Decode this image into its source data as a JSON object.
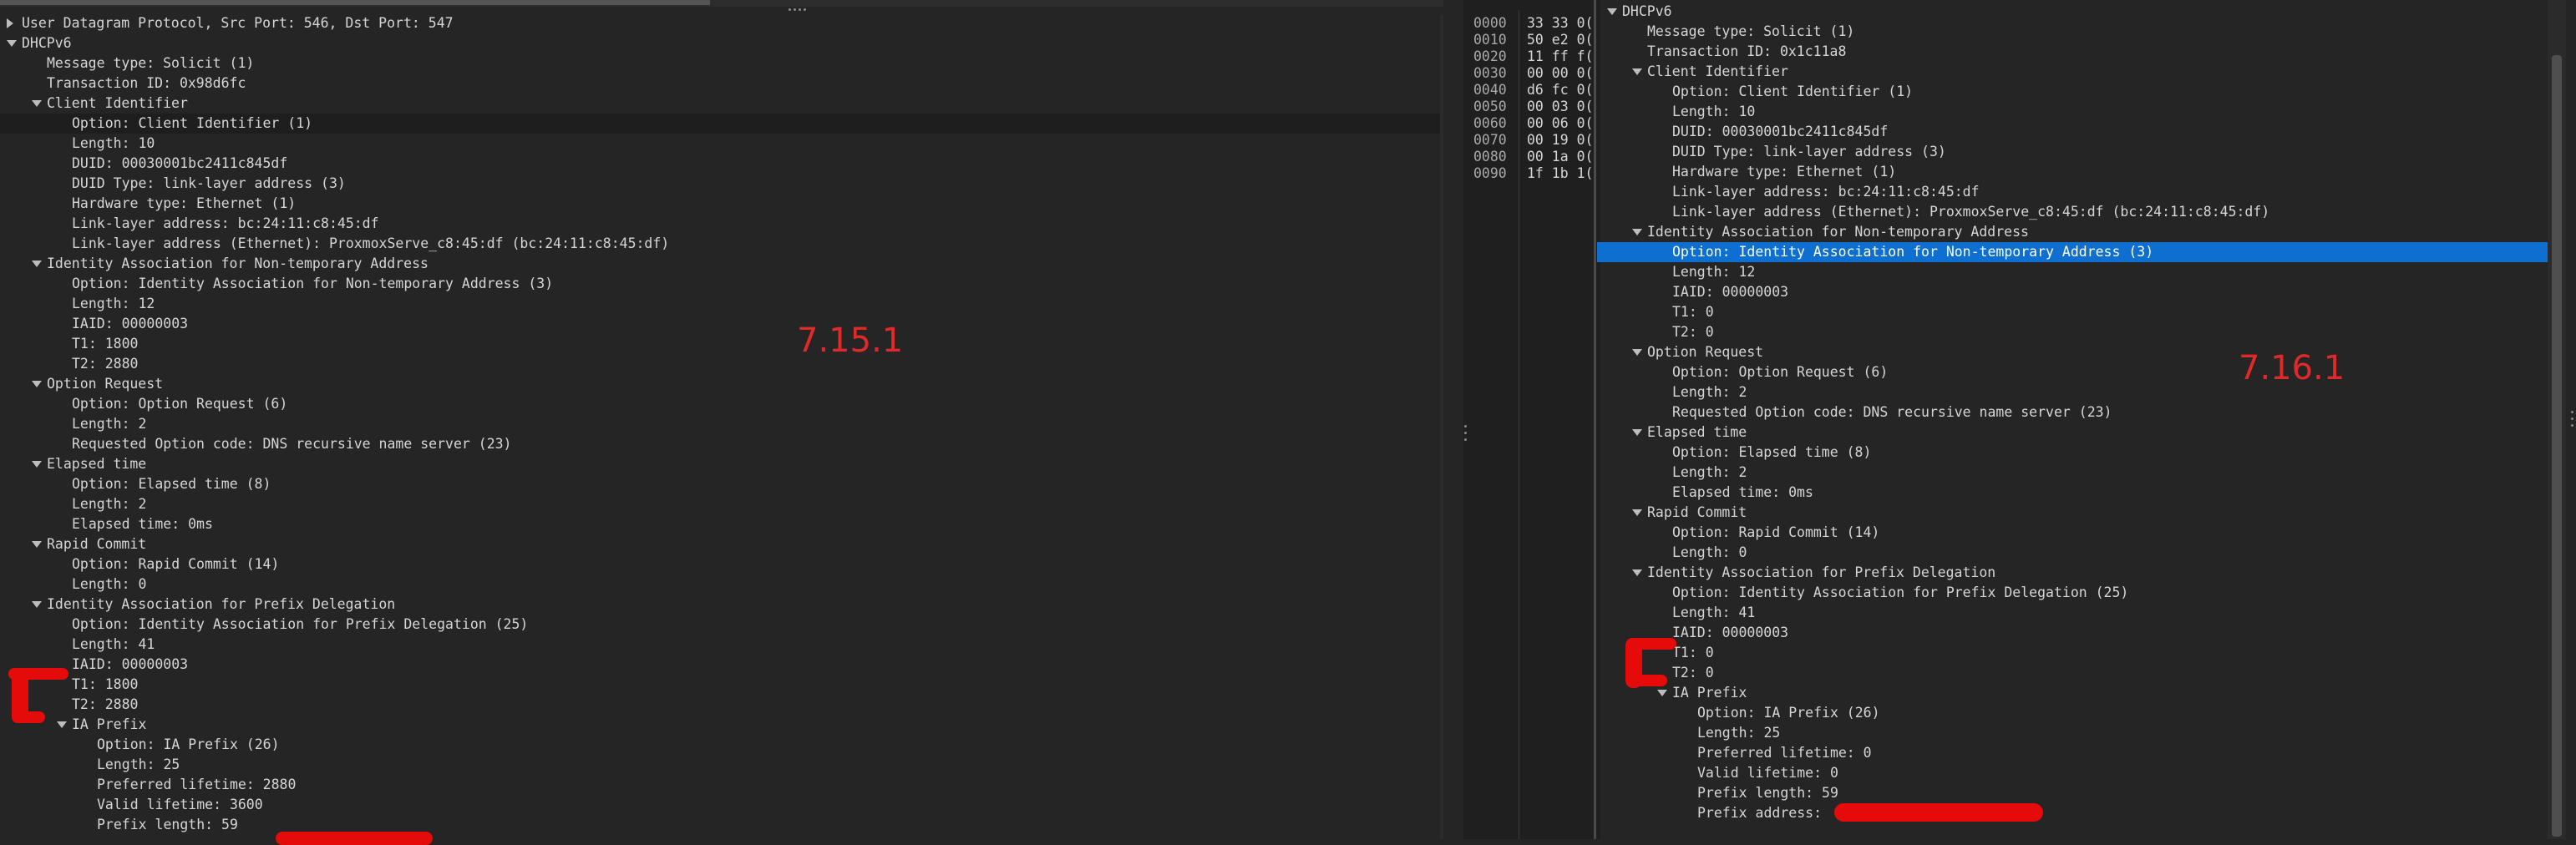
{
  "left": {
    "version_label": "7.15.1",
    "rows": [
      {
        "level": 0,
        "text": "User Datagram Protocol, Src Port: 546, Dst Port: 547",
        "expander": "right"
      },
      {
        "level": 0,
        "text": "DHCPv6",
        "expander": "down"
      },
      {
        "level": 1,
        "text": "Message type: Solicit (1)"
      },
      {
        "level": 1,
        "text": "Transaction ID: 0x98d6fc"
      },
      {
        "level": 1,
        "text": "Client Identifier",
        "expander": "down"
      },
      {
        "level": 2,
        "text": "Option: Client Identifier (1)",
        "highlight": true
      },
      {
        "level": 2,
        "text": "Length: 10"
      },
      {
        "level": 2,
        "text": "DUID: 00030001bc2411c845df"
      },
      {
        "level": 2,
        "text": "DUID Type: link-layer address (3)"
      },
      {
        "level": 2,
        "text": "Hardware type: Ethernet (1)"
      },
      {
        "level": 2,
        "text": "Link-layer address: bc:24:11:c8:45:df"
      },
      {
        "level": 2,
        "text": "Link-layer address (Ethernet): ProxmoxServe_c8:45:df (bc:24:11:c8:45:df)"
      },
      {
        "level": 1,
        "text": "Identity Association for Non-temporary Address",
        "expander": "down"
      },
      {
        "level": 2,
        "text": "Option: Identity Association for Non-temporary Address (3)"
      },
      {
        "level": 2,
        "text": "Length: 12"
      },
      {
        "level": 2,
        "text": "IAID: 00000003"
      },
      {
        "level": 2,
        "text": "T1: 1800"
      },
      {
        "level": 2,
        "text": "T2: 2880"
      },
      {
        "level": 1,
        "text": "Option Request",
        "expander": "down"
      },
      {
        "level": 2,
        "text": "Option: Option Request (6)"
      },
      {
        "level": 2,
        "text": "Length: 2"
      },
      {
        "level": 2,
        "text": "Requested Option code: DNS recursive name server (23)"
      },
      {
        "level": 1,
        "text": "Elapsed time",
        "expander": "down"
      },
      {
        "level": 2,
        "text": "Option: Elapsed time (8)"
      },
      {
        "level": 2,
        "text": "Length: 2"
      },
      {
        "level": 2,
        "text": "Elapsed time: 0ms"
      },
      {
        "level": 1,
        "text": "Rapid Commit",
        "expander": "down"
      },
      {
        "level": 2,
        "text": "Option: Rapid Commit (14)"
      },
      {
        "level": 2,
        "text": "Length: 0"
      },
      {
        "level": 1,
        "text": "Identity Association for Prefix Delegation",
        "expander": "down"
      },
      {
        "level": 2,
        "text": "Option: Identity Association for Prefix Delegation (25)"
      },
      {
        "level": 2,
        "text": "Length: 41"
      },
      {
        "level": 2,
        "text": "IAID: 00000003"
      },
      {
        "level": 2,
        "text": "T1: 1800"
      },
      {
        "level": 2,
        "text": "T2: 2880"
      },
      {
        "level": 2,
        "text": "IA Prefix",
        "expander": "down"
      },
      {
        "level": 3,
        "text": "Option: IA Prefix (26)"
      },
      {
        "level": 3,
        "text": "Length: 25"
      },
      {
        "level": 3,
        "text": "Preferred lifetime: 2880"
      },
      {
        "level": 3,
        "text": "Valid lifetime: 3600"
      },
      {
        "level": 3,
        "text": "Prefix length: 59"
      }
    ]
  },
  "hex": {
    "rows": [
      {
        "offset": "0000",
        "bytes": "33 33 0("
      },
      {
        "offset": "0010",
        "bytes": "50 e2 0("
      },
      {
        "offset": "0020",
        "bytes": "11 ff f("
      },
      {
        "offset": "0030",
        "bytes": "00 00 0("
      },
      {
        "offset": "0040",
        "bytes": "d6 fc 0("
      },
      {
        "offset": "0050",
        "bytes": "00 03 0("
      },
      {
        "offset": "0060",
        "bytes": "00 06 0("
      },
      {
        "offset": "0070",
        "bytes": "00 19 0("
      },
      {
        "offset": "0080",
        "bytes": "00 1a 0("
      },
      {
        "offset": "0090",
        "bytes": "1f 1b 1("
      }
    ]
  },
  "right": {
    "version_label": "7.16.1",
    "rows": [
      {
        "level": 0,
        "text": "DHCPv6",
        "expander": "down"
      },
      {
        "level": 1,
        "text": "Message type: Solicit (1)"
      },
      {
        "level": 1,
        "text": "Transaction ID: 0x1c11a8"
      },
      {
        "level": 1,
        "text": "Client Identifier",
        "expander": "down"
      },
      {
        "level": 2,
        "text": "Option: Client Identifier (1)"
      },
      {
        "level": 2,
        "text": "Length: 10"
      },
      {
        "level": 2,
        "text": "DUID: 00030001bc2411c845df"
      },
      {
        "level": 2,
        "text": "DUID Type: link-layer address (3)"
      },
      {
        "level": 2,
        "text": "Hardware type: Ethernet (1)"
      },
      {
        "level": 2,
        "text": "Link-layer address: bc:24:11:c8:45:df"
      },
      {
        "level": 2,
        "text": "Link-layer address (Ethernet): ProxmoxServe_c8:45:df (bc:24:11:c8:45:df)"
      },
      {
        "level": 1,
        "text": "Identity Association for Non-temporary Address",
        "expander": "down"
      },
      {
        "level": 2,
        "text": "Option: Identity Association for Non-temporary Address (3)",
        "selected": true
      },
      {
        "level": 2,
        "text": "Length: 12"
      },
      {
        "level": 2,
        "text": "IAID: 00000003"
      },
      {
        "level": 2,
        "text": "T1: 0"
      },
      {
        "level": 2,
        "text": "T2: 0"
      },
      {
        "level": 1,
        "text": "Option Request",
        "expander": "down"
      },
      {
        "level": 2,
        "text": "Option: Option Request (6)"
      },
      {
        "level": 2,
        "text": "Length: 2"
      },
      {
        "level": 2,
        "text": "Requested Option code: DNS recursive name server (23)"
      },
      {
        "level": 1,
        "text": "Elapsed time",
        "expander": "down"
      },
      {
        "level": 2,
        "text": "Option: Elapsed time (8)"
      },
      {
        "level": 2,
        "text": "Length: 2"
      },
      {
        "level": 2,
        "text": "Elapsed time: 0ms"
      },
      {
        "level": 1,
        "text": "Rapid Commit",
        "expander": "down"
      },
      {
        "level": 2,
        "text": "Option: Rapid Commit (14)"
      },
      {
        "level": 2,
        "text": "Length: 0"
      },
      {
        "level": 1,
        "text": "Identity Association for Prefix Delegation",
        "expander": "down"
      },
      {
        "level": 2,
        "text": "Option: Identity Association for Prefix Delegation (25)"
      },
      {
        "level": 2,
        "text": "Length: 41"
      },
      {
        "level": 2,
        "text": "IAID: 00000003"
      },
      {
        "level": 2,
        "text": "T1: 0"
      },
      {
        "level": 2,
        "text": "T2: 0"
      },
      {
        "level": 2,
        "text": "IA Prefix",
        "expander": "down"
      },
      {
        "level": 3,
        "text": "Option: IA Prefix (26)"
      },
      {
        "level": 3,
        "text": "Length: 25"
      },
      {
        "level": 3,
        "text": "Preferred lifetime: 0"
      },
      {
        "level": 3,
        "text": "Valid lifetime: 0"
      },
      {
        "level": 3,
        "text": "Prefix length: 59"
      },
      {
        "level": 3,
        "text": "Prefix address:"
      }
    ]
  },
  "colors": {
    "background": "#252526",
    "text": "#d6d6d6",
    "selection": "#0f6fd0",
    "row_highlight": "#1e1e1e",
    "annotation_red": "#e02a2a"
  }
}
